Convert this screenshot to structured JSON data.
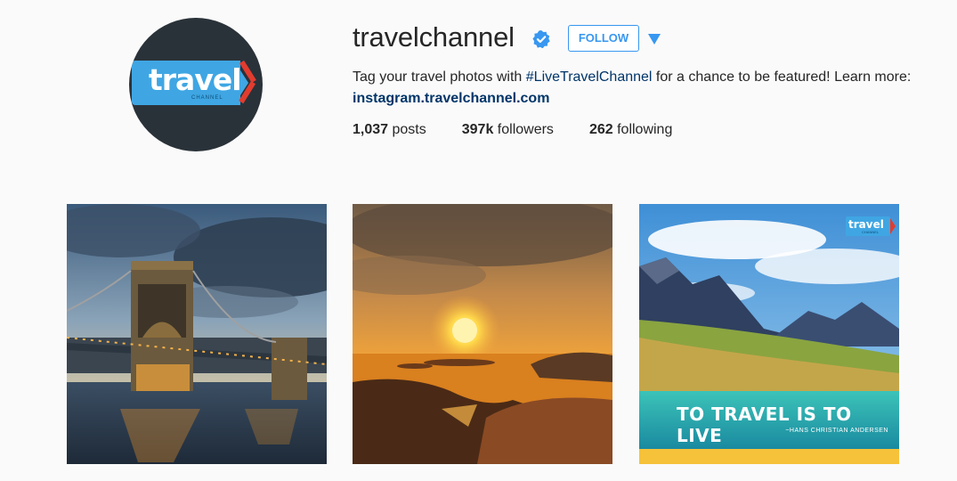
{
  "profile": {
    "username": "travelchannel",
    "follow_label": "FOLLOW",
    "bio": {
      "prefix": "Tag your travel photos with ",
      "hashtag": "#LiveTravelChannel",
      "suffix": " for a chance to be featured! Learn more: ",
      "link": "instagram.travelchannel.com"
    },
    "stats": [
      {
        "value": "1,037",
        "label": "posts"
      },
      {
        "value": "397k",
        "label": "followers"
      },
      {
        "value": "262",
        "label": "following"
      }
    ],
    "avatar_logo": {
      "word": "travel",
      "sub": "CHANNEL"
    }
  },
  "posts": [
    {
      "subject": "chain bridge at dusk"
    },
    {
      "subject": "sunset over sea"
    },
    {
      "subject": "mountain lake",
      "overlay_logo": "travel",
      "overlay_logo_sub": "CHANNEL",
      "caption": "TO TRAVEL IS TO LIVE",
      "attribution": "~HANS CHRISTIAN ANDERSEN"
    }
  ],
  "colors": {
    "accent": "#3897f0",
    "link": "#003569",
    "logo_blue": "#3fa6e3",
    "logo_red": "#e23c2f",
    "avatar_bg": "#2a3239",
    "caption_bar": "#f6c23a"
  }
}
